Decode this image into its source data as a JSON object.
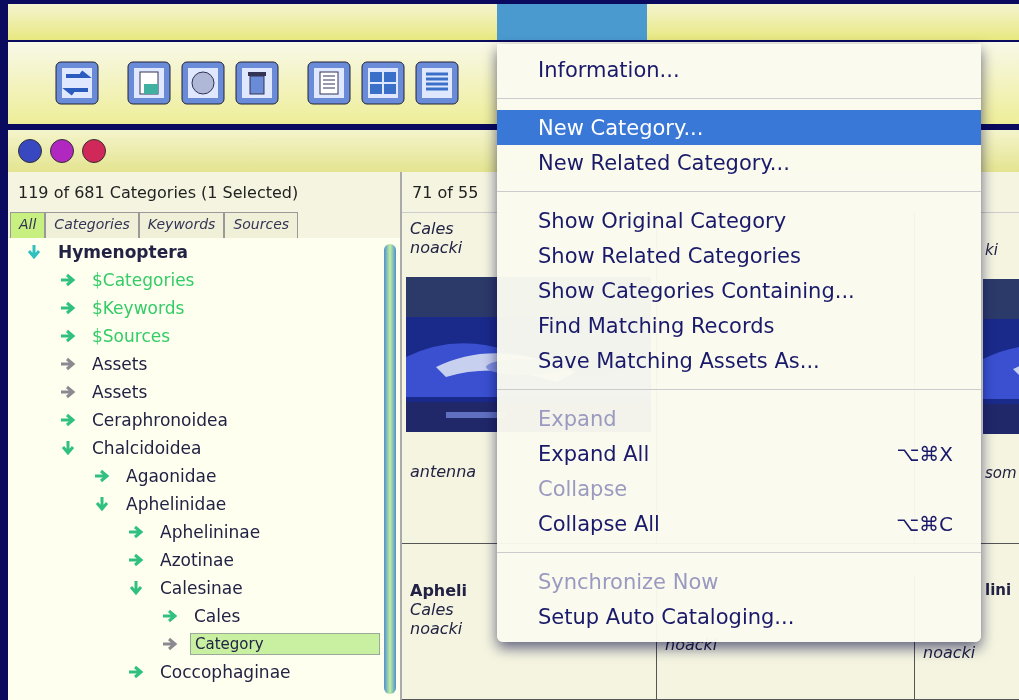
{
  "left_panel": {
    "summary": "119 of 681 Categories (1 Selected)",
    "tabs": [
      {
        "label": "All",
        "selected": true
      },
      {
        "label": "Categories",
        "selected": false
      },
      {
        "label": "Keywords",
        "selected": false
      },
      {
        "label": "Sources",
        "selected": false
      }
    ],
    "tree": [
      {
        "label": "Hymenoptera",
        "kind": "root",
        "expanded": true,
        "children": [
          {
            "label": "$Categories",
            "kind": "branch",
            "color": "#33cc66",
            "expanded": false
          },
          {
            "label": "$Keywords",
            "kind": "branch",
            "color": "#33cc66",
            "expanded": false
          },
          {
            "label": "$Sources",
            "kind": "branch",
            "color": "#33cc66",
            "expanded": false
          },
          {
            "label": "Assets",
            "kind": "leaf",
            "expanded": false
          },
          {
            "label": "Assets",
            "kind": "leaf",
            "expanded": false
          },
          {
            "label": "Ceraphronoidea",
            "kind": "branch",
            "expanded": false
          },
          {
            "label": "Chalcidoidea",
            "kind": "branch",
            "expanded": true,
            "children": [
              {
                "label": "Agaonidae",
                "kind": "branch",
                "expanded": false
              },
              {
                "label": "Aphelinidae",
                "kind": "branch",
                "expanded": true,
                "children": [
                  {
                    "label": "Aphelininae",
                    "kind": "branch",
                    "expanded": false
                  },
                  {
                    "label": "Azotinae",
                    "kind": "branch",
                    "expanded": false
                  },
                  {
                    "label": "Calesinae",
                    "kind": "branch",
                    "expanded": true,
                    "children": [
                      {
                        "label": "Cales",
                        "kind": "branch",
                        "expanded": false
                      },
                      {
                        "label": "Category",
                        "kind": "leaf",
                        "expanded": false,
                        "selected": true
                      }
                    ]
                  },
                  {
                    "label": "Coccophaginae",
                    "kind": "branch",
                    "expanded": false
                  }
                ]
              }
            ]
          }
        ]
      }
    ]
  },
  "right_panel": {
    "summary": "71 of 55",
    "columns": [
      {
        "rows": [
          {
            "lines": [
              {
                "text": "Cales",
                "kind": "italic"
              },
              {
                "text": "noacki",
                "kind": "italic"
              }
            ],
            "picture": true,
            "caption": "antenna"
          },
          {
            "lines": [
              {
                "text": "Apheli",
                "kind": "bold"
              },
              {
                "text": "Cales",
                "kind": "italic"
              },
              {
                "text": "noacki",
                "kind": "italic"
              }
            ]
          }
        ]
      },
      {
        "rows": [
          {
            "lines": []
          },
          {
            "lines": [
              {
                "text": "noacki",
                "kind": "italic"
              }
            ]
          }
        ]
      },
      {
        "rows": [
          {
            "lines": [
              {
                "text": "ki",
                "kind": "italic"
              }
            ],
            "picture": true,
            "caption": "som"
          },
          {
            "lines": [
              {
                "text": "lini",
                "kind": "bold"
              },
              {
                "text": "noacki",
                "kind": "italic"
              }
            ]
          }
        ]
      }
    ]
  },
  "menu": {
    "items": [
      {
        "label": "Information...",
        "kind": "item",
        "disabled": false,
        "selected": false
      },
      {
        "kind": "separator"
      },
      {
        "label": "New Category...",
        "kind": "item",
        "disabled": false,
        "selected": true
      },
      {
        "label": "New Related Category...",
        "kind": "item",
        "disabled": false,
        "selected": false
      },
      {
        "kind": "separator"
      },
      {
        "label": "Show Original Category",
        "kind": "item",
        "disabled": false,
        "selected": false
      },
      {
        "label": "Show Related Categories",
        "kind": "item",
        "disabled": false,
        "selected": false
      },
      {
        "label": "Show Categories Containing...",
        "kind": "item",
        "disabled": false,
        "selected": false
      },
      {
        "label": "Find Matching Records",
        "kind": "item",
        "disabled": false,
        "selected": false
      },
      {
        "label": "Save Matching Assets As...",
        "kind": "item",
        "disabled": false,
        "selected": false
      },
      {
        "kind": "separator"
      },
      {
        "label": "Expand",
        "kind": "item",
        "disabled": true,
        "selected": false
      },
      {
        "label": "Expand All",
        "kind": "item",
        "disabled": false,
        "selected": false,
        "shortcut": "⌥⌘X"
      },
      {
        "label": "Collapse",
        "kind": "item",
        "disabled": true,
        "selected": false
      },
      {
        "label": "Collapse All",
        "kind": "item",
        "disabled": false,
        "selected": false,
        "shortcut": "⌥⌘C"
      },
      {
        "kind": "separator"
      },
      {
        "label": "Synchronize Now",
        "kind": "item",
        "disabled": true,
        "selected": false
      },
      {
        "label": "Setup Auto Cataloging...",
        "kind": "item",
        "disabled": false,
        "selected": false
      }
    ]
  }
}
